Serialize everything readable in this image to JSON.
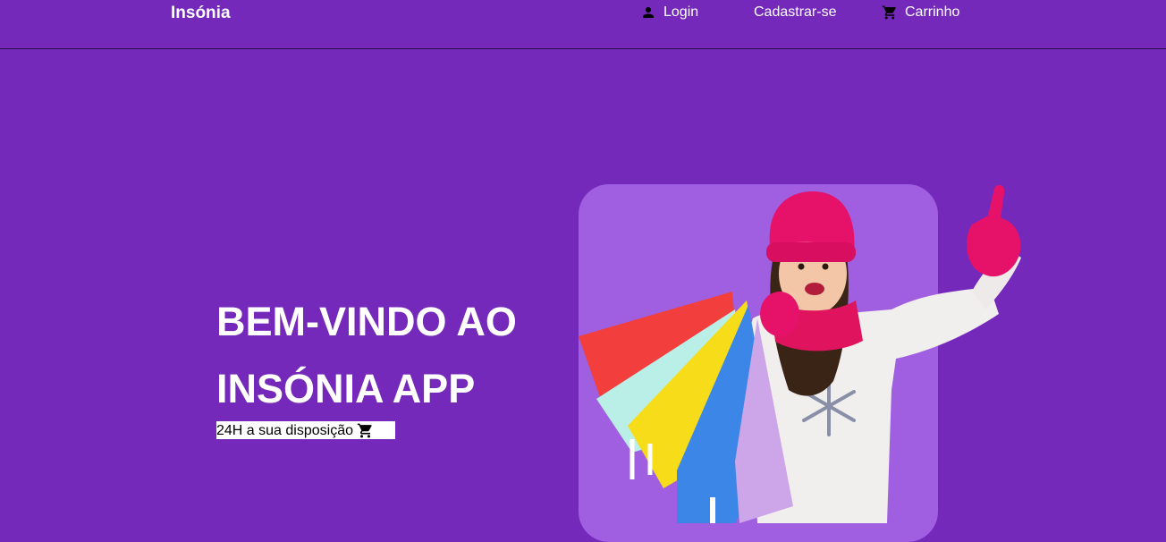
{
  "navbar": {
    "brand": "Insónia",
    "links": {
      "login": {
        "label": "Login",
        "icon": "user-icon"
      },
      "signup": {
        "label": "Cadastrar-se"
      },
      "cart": {
        "label": "Carrinho",
        "icon": "cart-icon"
      }
    }
  },
  "hero": {
    "title_line1": "BEM-VINDO AO",
    "title_line2": "INSÓNIA APP",
    "tagline": "24H a sua disposição",
    "tagline_icon": "cart-icon",
    "image": {
      "description": "girl-with-shopping-bags",
      "panel_color": "#9f5fe0"
    }
  },
  "colors": {
    "background": "#7429bb",
    "text": "#ffffff",
    "tagline_bg": "#ffffff",
    "tagline_text": "#000000"
  }
}
